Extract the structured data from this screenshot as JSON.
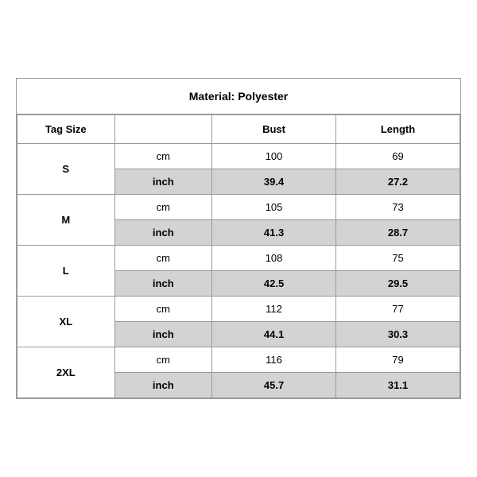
{
  "title": "Material: Polyester",
  "header": {
    "tag_size": "Tag Size",
    "bust": "Bust",
    "length": "Length"
  },
  "sizes": [
    {
      "tag": "S",
      "cm": {
        "bust": "100",
        "length": "69"
      },
      "inch": {
        "bust": "39.4",
        "length": "27.2"
      }
    },
    {
      "tag": "M",
      "cm": {
        "bust": "105",
        "length": "73"
      },
      "inch": {
        "bust": "41.3",
        "length": "28.7"
      }
    },
    {
      "tag": "L",
      "cm": {
        "bust": "108",
        "length": "75"
      },
      "inch": {
        "bust": "42.5",
        "length": "29.5"
      }
    },
    {
      "tag": "XL",
      "cm": {
        "bust": "112",
        "length": "77"
      },
      "inch": {
        "bust": "44.1",
        "length": "30.3"
      }
    },
    {
      "tag": "2XL",
      "cm": {
        "bust": "116",
        "length": "79"
      },
      "inch": {
        "bust": "45.7",
        "length": "31.1"
      }
    }
  ],
  "units": {
    "cm": "cm",
    "inch": "inch"
  }
}
